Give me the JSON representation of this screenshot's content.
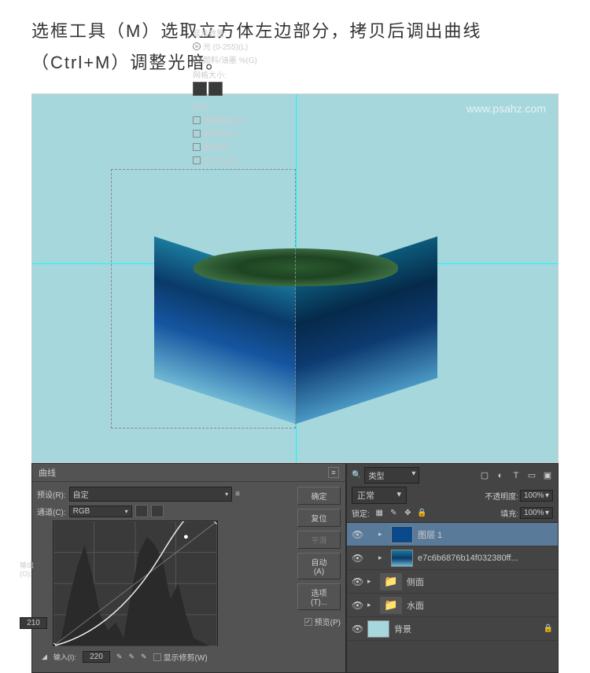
{
  "instruction": "选框工具（M）选取立方体左边部分，拷贝后调出曲线（Ctrl+M）调整光暗。",
  "watermark": "www.psahz.com",
  "curves": {
    "title": "曲线",
    "preset_label": "预设(R):",
    "preset_value": "自定",
    "channel_label": "通道(C):",
    "channel_value": "RGB",
    "output_label": "输出(O):",
    "output_value": "210",
    "input_label": "输入(I):",
    "input_value": "220",
    "show_clipping": "显示修剪(W)",
    "display_section": "显示数量:",
    "display_light": "光 (0-255)(L)",
    "display_pigment": "颜料/油墨 %(G)",
    "grid_label": "网格大小:",
    "show_label": "显示:",
    "chk_channel_overlay": "通道叠加(V)",
    "chk_histogram": "直方图(H)",
    "chk_baseline": "基线(B)",
    "chk_intersection": "交叉线(N)",
    "btn_ok": "确定",
    "btn_cancel": "复位",
    "btn_smooth": "平滑",
    "btn_auto": "自动(A)",
    "btn_options": "选项(T)...",
    "chk_preview": "预览(P)"
  },
  "layers": {
    "type_label": "类型",
    "blend_mode": "正常",
    "opacity_label": "不透明度:",
    "opacity_value": "100%",
    "lock_label": "锁定:",
    "fill_label": "填充:",
    "fill_value": "100%",
    "items": [
      {
        "name": "图层 1",
        "selected": true,
        "kind": "layer",
        "thumb": "blue"
      },
      {
        "name": "e7c6b6876b14f032380ff...",
        "selected": false,
        "kind": "layer",
        "thumb": "sea"
      },
      {
        "name": "侧面",
        "selected": false,
        "kind": "folder"
      },
      {
        "name": "水面",
        "selected": false,
        "kind": "folder"
      },
      {
        "name": "背景",
        "selected": false,
        "kind": "bg",
        "locked": true
      }
    ]
  },
  "icons": {
    "search": "🔍",
    "close": "×",
    "eye": "👁",
    "folder": "📁",
    "lock": "🔒",
    "gear": "⚙",
    "dropdown": "▾",
    "menu": "≡",
    "toggle": "▸",
    "image": "▢",
    "adjust": "◐",
    "text": "T",
    "shape": "▭",
    "smart": "▣",
    "brush": "✎",
    "move": "✥",
    "checker": "▦"
  }
}
